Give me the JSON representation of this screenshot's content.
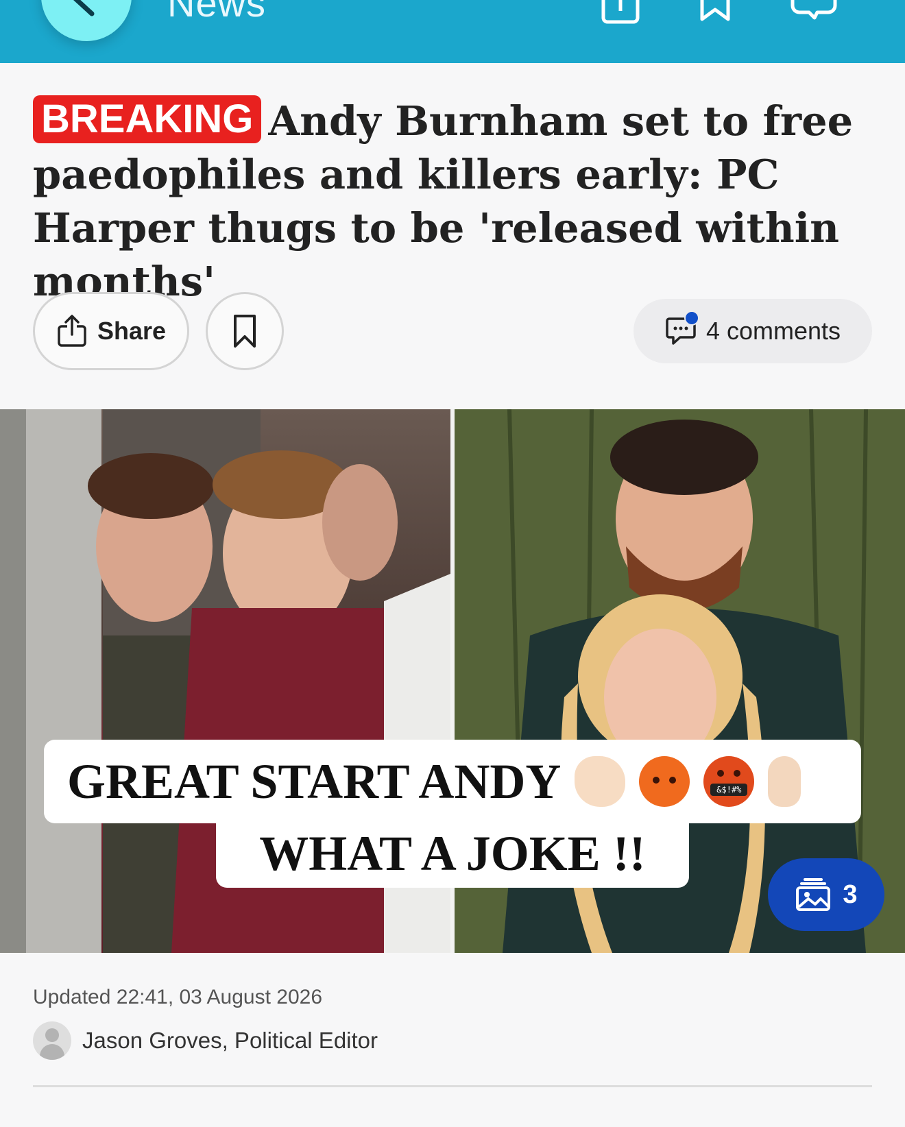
{
  "header": {
    "title": "News",
    "icons": [
      "back-icon",
      "share-icon",
      "bookmark-icon",
      "comment-icon"
    ],
    "colors": {
      "bar": "#1ba7cc",
      "back_button": "#7df0f4"
    }
  },
  "article": {
    "badge": "BREAKING",
    "headline": "Andy Burnham set to free paedophiles and killers early: PC Harper thugs to be 'released within months'",
    "actions": {
      "share_label": "Share",
      "comments_label": "4 comments"
    },
    "hero": {
      "caption_line1": "GREAT START ANDY",
      "caption_line2": "WHAT A JOKE !!",
      "emojis": [
        "ok-hand-emoji",
        "angry-face-emoji",
        "cursing-face-emoji",
        "middle-finger-emoji"
      ],
      "cursing_symbols": "&$!#%",
      "gallery_count": "3"
    },
    "updated": "Updated 22:41, 03 August 2026",
    "author": "Jason Groves, Political Editor"
  },
  "colors": {
    "breaking": "#e8211f",
    "gallery_button": "#1347b8",
    "notification_dot": "#1250c9"
  }
}
